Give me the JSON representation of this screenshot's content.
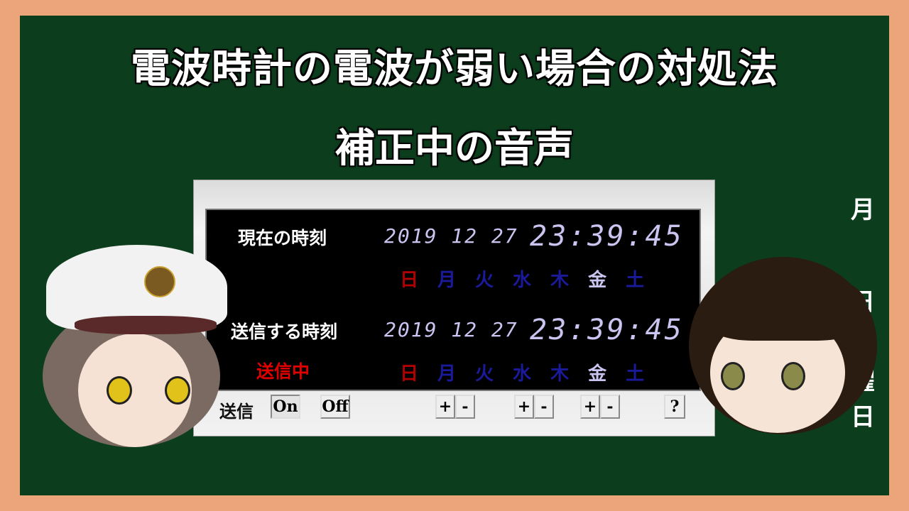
{
  "title": "電波時計の電波が弱い場合の対処法",
  "subtitle": "補正中の音声",
  "side_text": [
    "月",
    "日",
    "曜",
    "日"
  ],
  "clock": {
    "current_label": "現在の時刻",
    "current_date": "2019 12 27",
    "current_time": "23:39:45",
    "send_label": "送信する時刻",
    "send_date": "2019 12 27",
    "send_time": "23:39:45",
    "status": "送信中",
    "weekdays": [
      "日",
      "月",
      "火",
      "水",
      "木",
      "金",
      "土"
    ],
    "active_weekday": "金",
    "colors": {
      "sunday": "#b00000",
      "inactive": "#1a1a9a",
      "active": "#c9c4f0",
      "status": "#e00000"
    },
    "controls": {
      "send_label": "送信",
      "on": "On",
      "off": "Off",
      "plus": "+",
      "minus": "-",
      "help": "?"
    }
  }
}
